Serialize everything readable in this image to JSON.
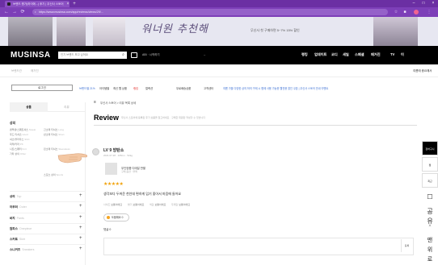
{
  "browser": {
    "tab_title": "브랜드 평가(하이에...) 후기 | 무신사 스토어",
    "address": "https://www.musinsa.com/app/reviews/views/29/...",
    "tab_close": "×",
    "new_tab": "+",
    "win_min": "–",
    "win_max": "□",
    "win_close": "×",
    "back": "←",
    "forward": "→",
    "reload": "⟳",
    "lock": "🔒",
    "star_icon": "☆",
    "ext_icon": "⋮"
  },
  "banner": {
    "script_text": "워너원 추천해",
    "promo": "무신사 첫 구매하면 5~7% 15% 할인"
  },
  "header": {
    "logo": "MUSINSA",
    "search_placeholder": "인기 브랜드 보고 싶어요",
    "sub_label": "ABI · 시작하기",
    "dash": "–",
    "gnb": [
      "랭킹",
      "업데이트",
      "코디",
      "세일",
      "스페셜",
      "매거진",
      "TV",
      "이"
    ]
  },
  "subnav": {
    "left": [
      "브랜드관",
      "매거진"
    ],
    "right": "여름에 중요해서"
  },
  "catbar": {
    "button": "로그인",
    "items": [
      "브랜드별 21%",
      "아이템별",
      "최신 웹 상품",
      "랭킹",
      "컬렉션",
      "무료배송상품",
      "고객센터"
    ],
    "notice": "여름 가을 다양한 상의 하의 구매 시 함께 사용 가능한 웹전용 할인 쿠폰 | 무신사 스토어 안내 이벤트"
  },
  "sidebar": {
    "tab_active": "상품",
    "tab_other": "리뷰",
    "category_head": "상의",
    "category_items": [
      {
        "ko": "맨투맨/스웨트셔츠",
        "en": "Sweat"
      },
      {
        "ko": "후드 티셔츠",
        "en": "Hood"
      },
      {
        "ko": "셔츠/블라우스",
        "en": "Shirt"
      },
      {
        "ko": "피케/카라",
        "en": "PK"
      },
      {
        "ko": "니트/스웨터",
        "en": "Knit"
      },
      {
        "ko": "기타 상의",
        "en": "Other"
      },
      {
        "ko": "긴소매 티셔츠",
        "en": "Long"
      },
      {
        "ko": "반소매 티셔츠",
        "en": "Short"
      },
      {
        "ko": "민소매 티셔츠",
        "en": "Sleeveless"
      },
      {
        "ko": "스포츠 상의",
        "en": "Sports"
      }
    ],
    "rows": [
      {
        "ko": "상의",
        "en": "Top"
      },
      {
        "ko": "아우터",
        "en": "Outer"
      },
      {
        "ko": "바지",
        "en": "Pants"
      },
      {
        "ko": "원피스",
        "en": "Onepiece"
      },
      {
        "ko": "스커트",
        "en": "Skirt"
      },
      {
        "ko": "스니커즈",
        "en": "Sneakers"
      }
    ],
    "plus": "+"
  },
  "main": {
    "breadcrumb": "무신사 스토어 > 리뷰 목록 상세",
    "review_title": "Review",
    "review_desc": "무신사 스토어에 등록된 후기 상품을 참고하세요 · 구매한 회원만 작성할 수 있습니다",
    "user_name": "LV 9 방탄소",
    "user_info": "2021.07.28 · 165cm · 52kg",
    "product_name": "무인양품 디테일 반팔",
    "product_option": "구매 옵션 : 블랙",
    "stars": "★★★★★",
    "review_text": "생각보다 두꺼운 천인데 편하게 입기 좋아서 마음에 들어요",
    "tags": [
      {
        "k": "사이즈",
        "v": "보통이에요"
      },
      {
        "k": "밝기",
        "v": "보통이에요"
      },
      {
        "k": "색감",
        "v": "보통이에요"
      },
      {
        "k": "두께감",
        "v": "보통이에요"
      }
    ],
    "helpful": "도움돼요 0",
    "comment_label": "댓글 0",
    "comment_btn": "등록"
  },
  "rail": {
    "items": [
      "장바구니",
      "찜",
      "최근",
      "공유",
      "맨위로"
    ]
  },
  "colors": {
    "browser_tab": "#6b2fa3",
    "browser_toolbar": "#7d3fb8",
    "header_bg": "#000000",
    "accent_star": "#f1a20b",
    "notice_blue": "#3b6fd4"
  }
}
